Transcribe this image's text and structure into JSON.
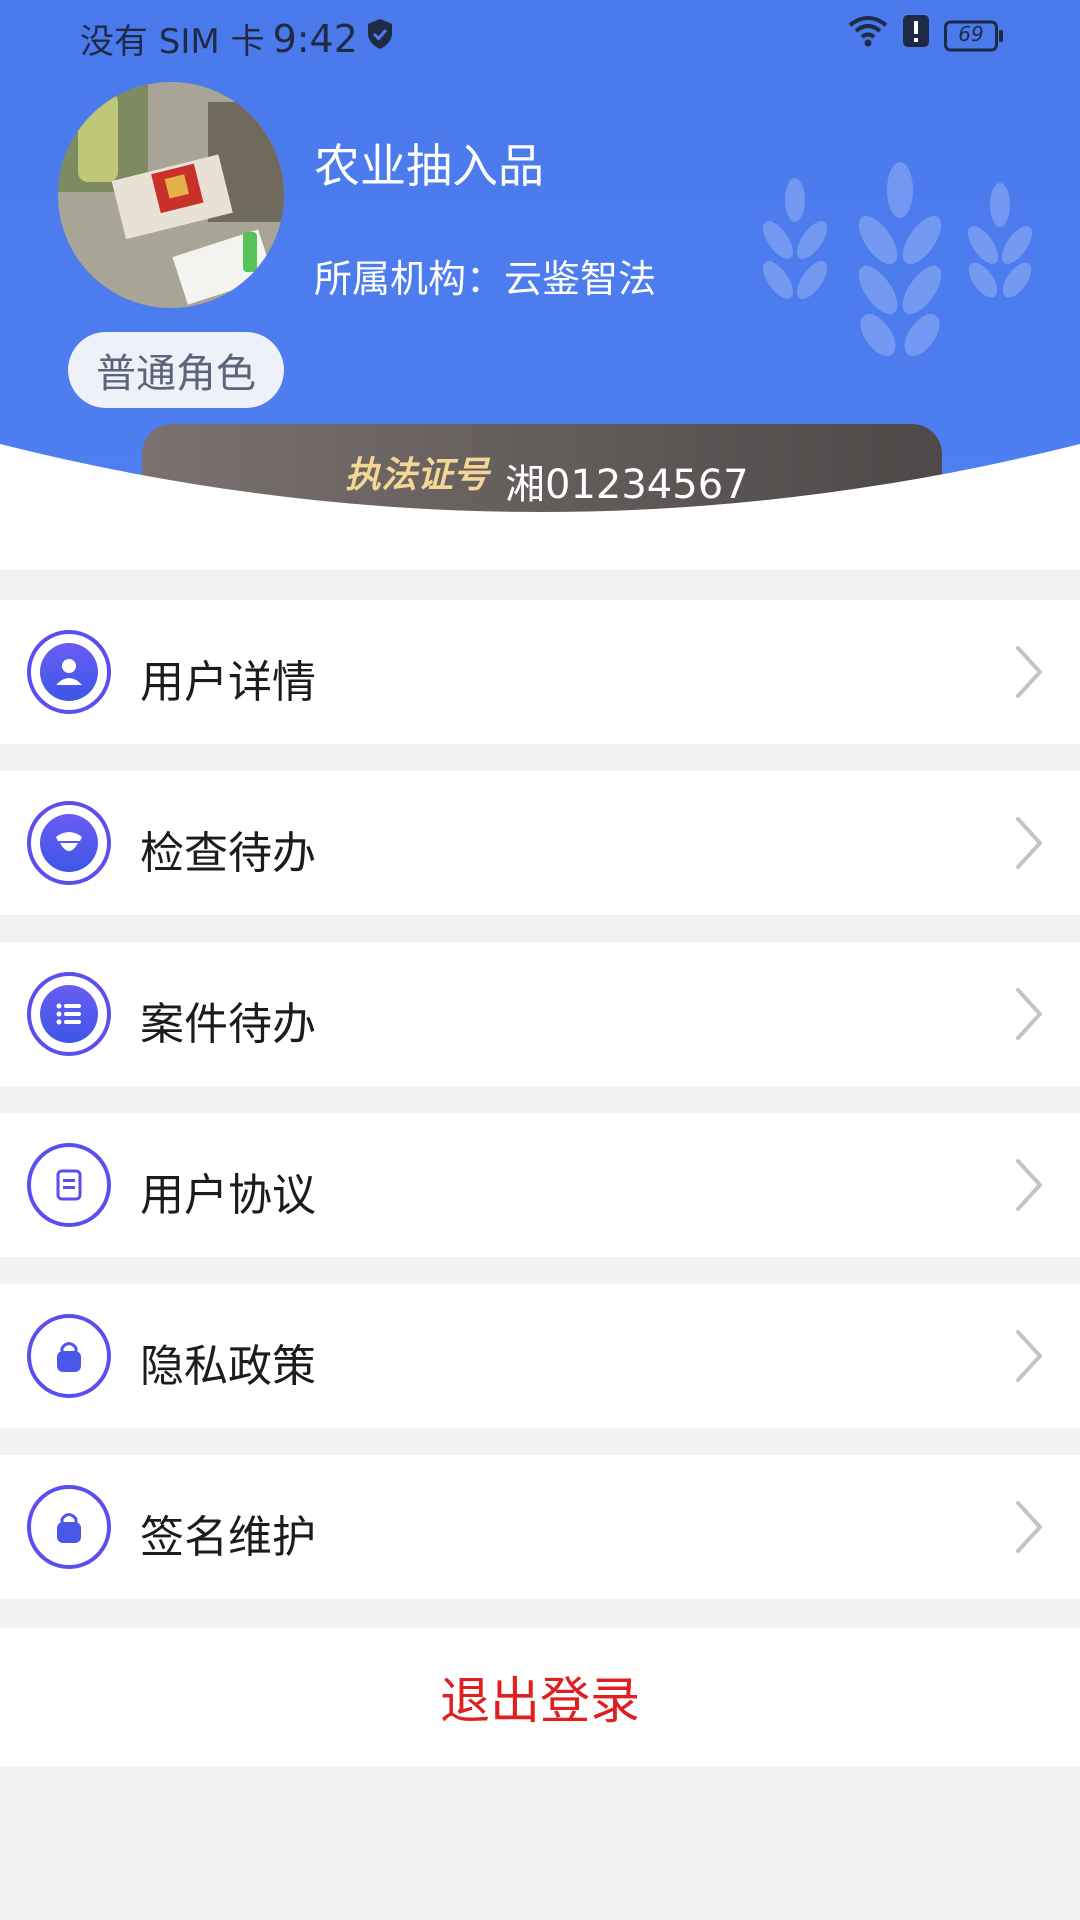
{
  "status_bar": {
    "carrier": "没有 SIM 卡",
    "time": "9:42",
    "battery": "69"
  },
  "profile": {
    "name": "农业抽入品",
    "org_label": "所属机构：",
    "org_name": "云鉴智法",
    "role": "普通角色",
    "cert_label": "执法证号",
    "cert_number": "湘01234567"
  },
  "menu": [
    {
      "label": "用户详情",
      "icon": "user-icon"
    },
    {
      "label": "检查待办",
      "icon": "inspector-icon"
    },
    {
      "label": "案件待办",
      "icon": "list-icon"
    },
    {
      "label": "用户协议",
      "icon": "document-icon"
    },
    {
      "label": "隐私政策",
      "icon": "lock-icon"
    },
    {
      "label": "签名维护",
      "icon": "lock-icon"
    }
  ],
  "logout_label": "退出登录",
  "colors": {
    "header_blue": "#4e7ff0",
    "icon_purple": "#5a4ef0",
    "logout_red": "#e02020",
    "cert_gold": "#f3d793"
  }
}
